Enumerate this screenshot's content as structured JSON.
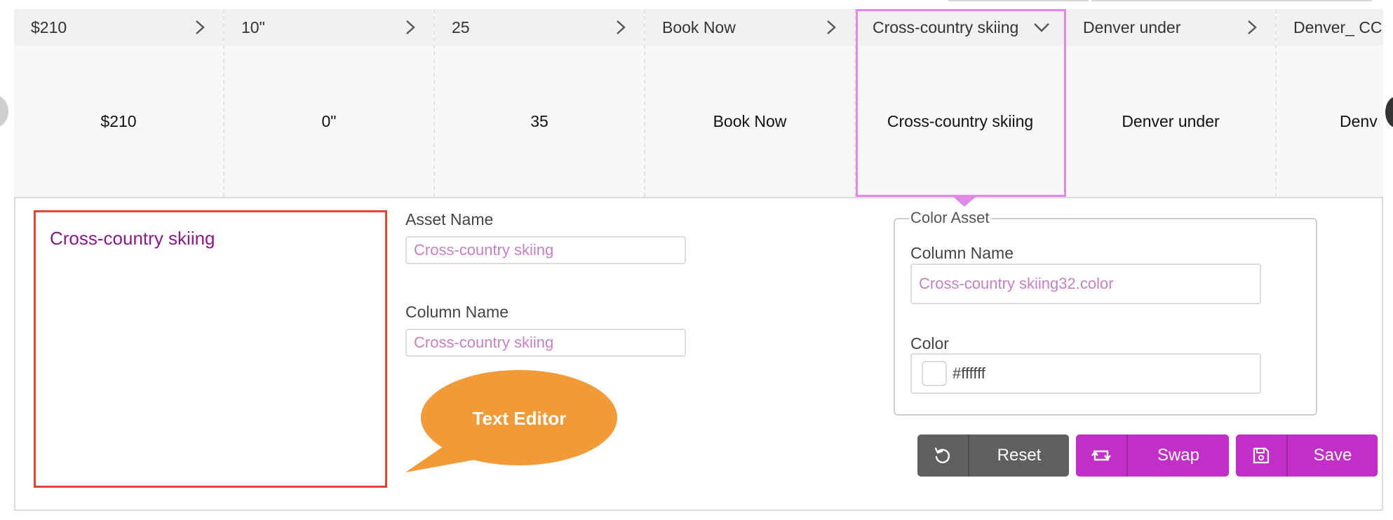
{
  "columns": [
    {
      "header": "$210",
      "value": "$210",
      "chevron": "chevron-right-icon"
    },
    {
      "header": "10\"",
      "value": "0\"",
      "chevron": "chevron-right-icon"
    },
    {
      "header": "25",
      "value": "35",
      "chevron": "chevron-right-icon"
    },
    {
      "header": "Book Now",
      "value": "Book Now",
      "chevron": "chevron-right-icon"
    },
    {
      "header": "Cross-country skiing",
      "value": "Cross-country skiing",
      "chevron": "chevron-down-icon",
      "selected": true
    },
    {
      "header": "Denver under",
      "value": "Denver under",
      "chevron": "chevron-right-icon"
    },
    {
      "header": "Denver_ CC",
      "value": "Denv",
      "chevron": "chevron-right-icon"
    }
  ],
  "editor": {
    "preview_text": "Cross-country skiing",
    "asset_name_label": "Asset Name",
    "asset_name_value": "Cross-country skiing",
    "column_name_label": "Column Name",
    "column_name_value": "Cross-country skiing",
    "bubble_label": "Text Editor"
  },
  "color_asset": {
    "legend": "Color Asset",
    "column_name_label": "Column Name",
    "column_name_value": "Cross-country skiing32.color",
    "color_label": "Color",
    "color_value": "#ffffff"
  },
  "buttons": {
    "reset_label": "Reset",
    "swap_label": "Swap",
    "save_label": "Save"
  },
  "colors": {
    "accent": "#c12fc8",
    "selection_outline": "#e08ae8",
    "preview_border": "#e44530",
    "bubble": "#f09a38",
    "reset_button": "#606060"
  }
}
